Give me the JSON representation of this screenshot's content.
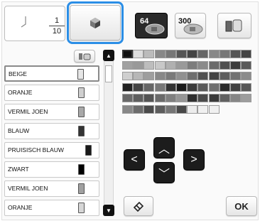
{
  "header": {
    "fraction_num": "1",
    "fraction_den": "10",
    "btn_64_label": "64",
    "btn_300_label": "300"
  },
  "threads": [
    {
      "name": "BEIGE",
      "color": "#e6e6e6",
      "selected": true
    },
    {
      "name": "ORANJE",
      "color": "#cfcfcf",
      "selected": false
    },
    {
      "name": "VERMIL JOEN",
      "color": "#a8a8a8",
      "selected": false
    },
    {
      "name": "BLAUW",
      "color": "#333333",
      "selected": false
    },
    {
      "name": "PRUISISCH BLAUW",
      "color": "#1a1a1a",
      "selected": false
    },
    {
      "name": "ZWART",
      "color": "#000000",
      "selected": false
    },
    {
      "name": "VERMIL JOEN",
      "color": "#a0a0a0",
      "selected": false
    },
    {
      "name": "ORANJE",
      "color": "#d6d6d6",
      "selected": false
    }
  ],
  "palette_rows": [
    [
      "#111111",
      "#dddddd",
      "#bbbbbb",
      "#888888",
      "#777777",
      "#555555",
      "#444444",
      "#666666",
      "#888888",
      "#777777",
      "#555555",
      "#444444"
    ],
    [
      "#a0a0a0",
      "#999999",
      "#bdbdbd",
      "#c8c8c8",
      "#b0b0b0",
      "#9a9a9a",
      "#7d7d7d",
      "#8a8a8a",
      "#6b6b6b",
      "#505050",
      "#3c3c3c",
      "#595959"
    ],
    [
      "#cfcfcf",
      "#b7b7b7",
      "#9e9e9e",
      "#888888",
      "#7a7a7a",
      "#909090",
      "#6e6e6e",
      "#515151",
      "#444444",
      "#5d5d5d",
      "#727272",
      "#8c8c8c"
    ],
    [
      "#222222",
      "#444444",
      "#666666",
      "#777777",
      "#333333",
      "#1a1a1a",
      "#3b3b3b",
      "#5a5a5a",
      "#6f6f6f",
      "#2a2a2a",
      "#404040",
      "#575757"
    ],
    [
      "#696969",
      "#5f5f5f",
      "#545454",
      "#6a6a6a",
      "#7f7f7f",
      "#959595",
      "#2f2f2f",
      "#4b4b4b",
      "#3a3a3a",
      "#616161",
      "#868686",
      "#9d9d9d"
    ],
    [
      "#888888",
      "#6c6c6c",
      "#4a4a4a",
      "#5c5c5c",
      "#757575",
      "#484848",
      "#ececec",
      "#f0f0f0",
      "#f0f0f0",
      "",
      "",
      ""
    ]
  ],
  "buttons": {
    "ok_label": "OK"
  }
}
